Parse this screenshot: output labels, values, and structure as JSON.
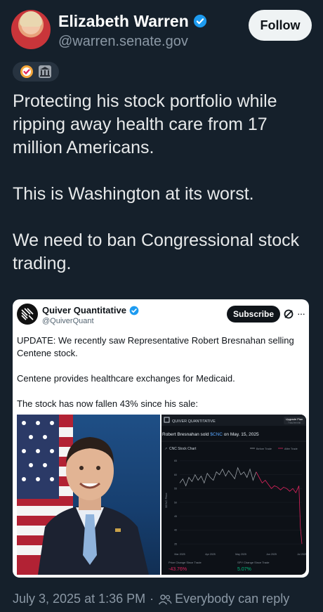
{
  "author": {
    "display_name": "Elizabeth Warren",
    "handle": "@warren.senate.gov",
    "follow_label": "Follow"
  },
  "badges": [
    "check-badge-icon",
    "government-building-icon"
  ],
  "tweet": {
    "paragraphs": [
      "Protecting his stock portfolio while ripping away health care from 17 million Americans.",
      "This is Washington at its worst.",
      "We need to ban Congressional stock trading."
    ]
  },
  "quote": {
    "display_name": "Quiver Quantitative",
    "handle": "@QuiverQuant",
    "subscribe_label": "Subscribe",
    "more_label": "···",
    "paragraphs": [
      "UPDATE: We recently saw Representative Robert Bresnahan selling Centene stock.",
      "Centene provides healthcare exchanges for Medicaid.",
      "The stock has now fallen 43% since his sale:"
    ],
    "chart_image": {
      "brand": "QUIVER QUANTITATIVE",
      "upgrade_label": "Upgrade Plan",
      "upgrade_sub": "7-day free trial",
      "headline_pre": "Robert Bresnahan sold ",
      "headline_ticker": "$CNC",
      "headline_post": " on May. 15, 2025",
      "chart_title": "CNC Stock Chart",
      "legend_before": "Before Trade",
      "legend_after": "After Trade",
      "ylabel": "$CNC Price",
      "stat1_label": "Price Change Since Trade",
      "stat1_value": "-43.76%",
      "stat2_label": "SPY Change Since Trade",
      "stat2_value": "5.07%"
    }
  },
  "chart_data": {
    "type": "line",
    "title": "CNC Stock Chart",
    "ylabel": "$CNC Price",
    "x_ticks": [
      "Mar 2025",
      "Apr 2025",
      "May 2025",
      "Jun 2025",
      "Jul 2025"
    ],
    "y_ticks": [
      35,
      40,
      45,
      50,
      55,
      60,
      65
    ],
    "ylim": [
      33,
      67
    ],
    "series": [
      {
        "name": "Before Trade",
        "color": "#9aa0a6",
        "x": [
          0.0,
          0.1,
          0.2,
          0.3,
          0.4,
          0.5,
          0.6,
          0.7,
          0.8,
          0.9,
          1.0,
          1.1,
          1.2,
          1.3,
          1.4,
          1.5,
          1.6,
          1.7,
          1.8,
          1.9,
          2.0,
          2.1,
          2.2,
          2.3,
          2.4,
          2.5
        ],
        "y": [
          57,
          58.5,
          56,
          59,
          57.5,
          60,
          58,
          59.5,
          57,
          60.5,
          59,
          58,
          61,
          60,
          62,
          59.5,
          61.5,
          60,
          58.5,
          62.5,
          60,
          61,
          59,
          62,
          58,
          61
        ]
      },
      {
        "name": "After Trade",
        "color": "#e0245e",
        "x": [
          2.5,
          2.6,
          2.7,
          2.8,
          2.9,
          3.0,
          3.1,
          3.2,
          3.3,
          3.4,
          3.5,
          3.6,
          3.7,
          3.8,
          3.9,
          3.95,
          4.0
        ],
        "y": [
          61,
          59,
          57,
          58,
          56.5,
          55,
          56,
          55.5,
          54.5,
          55.5,
          55,
          54,
          55,
          53.5,
          56,
          41,
          35
        ]
      }
    ]
  },
  "footer": {
    "timestamp": "July 3, 2025 at 1:36 PM",
    "reply_setting": "Everybody can reply"
  },
  "colors": {
    "background": "#15202b",
    "verified_blue": "#1d9bf0",
    "after_trade_red": "#e0245e",
    "spy_green": "#00ba7c"
  }
}
